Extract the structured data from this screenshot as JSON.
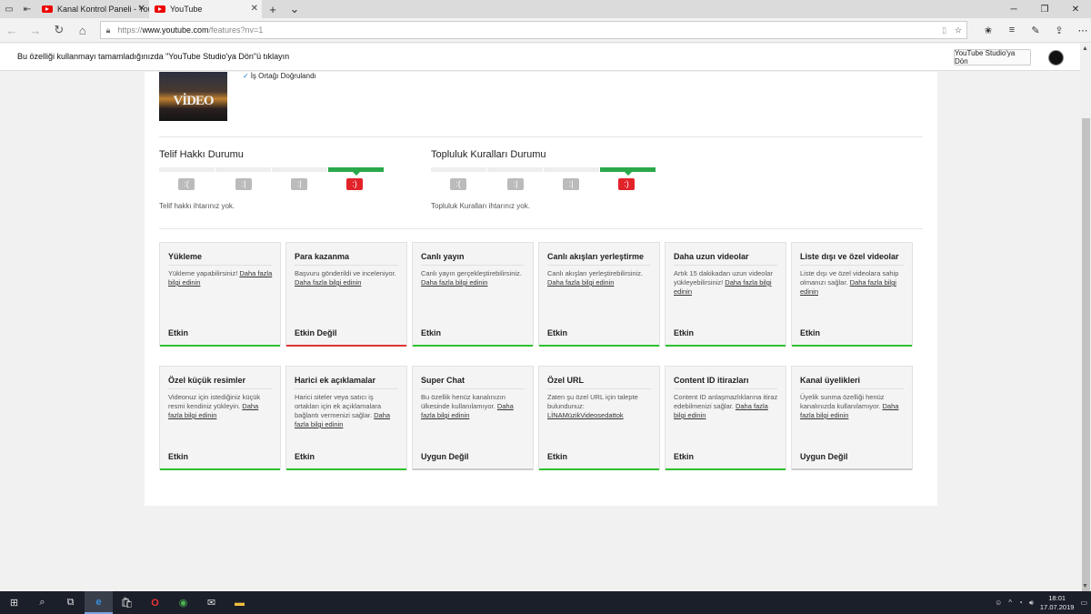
{
  "browser": {
    "tabs": [
      {
        "title": "Kanal Kontrol Paneli - YouTu",
        "active": false
      },
      {
        "title": "YouTube",
        "active": true
      }
    ],
    "url_prefix": "https://",
    "url_domain": "www.youtube.com",
    "url_path": "/features?nv=1"
  },
  "studio_bar": {
    "message": "Bu özelliği kullanmayı tamamladığınızda \"YouTube Studio'ya Dön\"ü tıklayın",
    "button": "YouTube Studio'ya Dön"
  },
  "channel": {
    "thumb_text": "VİDEO",
    "verified_label": "İş Ortağı Doğrulandı"
  },
  "copyright": {
    "title": "Telif Hakkı Durumu",
    "note": "Telif hakkı ihtarınız yok.",
    "level": 4
  },
  "community": {
    "title": "Topluluk Kuralları Durumu",
    "note": "Topluluk Kuralları ihtarınız yok.",
    "level": 4
  },
  "features": [
    {
      "title": "Yükleme",
      "desc": "Yükleme yapabilirsiniz!",
      "link": "Daha fazla bilgi edinin",
      "status": "Etkin",
      "state": "green"
    },
    {
      "title": "Para kazanma",
      "desc": "Başvuru gönderildi ve inceleniyor.",
      "link": "Daha fazla bilgi edinin",
      "status": "Etkin Değil",
      "state": "red"
    },
    {
      "title": "Canlı yayın",
      "desc": "Canlı yayın gerçekleştirebilirsiniz.",
      "link": "Daha fazla bilgi edinin",
      "status": "Etkin",
      "state": "green"
    },
    {
      "title": "Canlı akışları yerleştirme",
      "desc": "Canlı akışları yerleştirebilirsiniz.",
      "link": "Daha fazla bilgi edinin",
      "status": "Etkin",
      "state": "green"
    },
    {
      "title": "Daha uzun videolar",
      "desc": "Artık 15 dakikadan uzun videolar yükleyebilirsiniz!",
      "link": "Daha fazla bilgi edinin",
      "status": "Etkin",
      "state": "green"
    },
    {
      "title": "Liste dışı ve özel videolar",
      "desc": "Liste dışı ve özel videolara sahip olmanızı sağlar.",
      "link": "Daha fazla bilgi edinin",
      "status": "Etkin",
      "state": "green"
    },
    {
      "title": "Özel küçük resimler",
      "desc": "Videonuz için istediğiniz küçük resmi kendiniz yükleyin.",
      "link": "Daha fazla bilgi edinin",
      "status": "Etkin",
      "state": "green"
    },
    {
      "title": "Harici ek açıklamalar",
      "desc": "Harici siteler veya satıcı iş ortakları için ek açıklamalara bağlantı vermenizi sağlar.",
      "link": "Daha fazla bilgi edinin",
      "status": "Etkin",
      "state": "green"
    },
    {
      "title": "Super Chat",
      "desc": "Bu özellik henüz kanalınızın ülkesinde kullanılamıyor.",
      "link": "Daha fazla bilgi edinin",
      "status": "Uygun Değil",
      "state": "grey"
    },
    {
      "title": "Özel URL",
      "desc": "Zaten şu özel URL için talepte bulundunuz:",
      "link": "LİNAMüzikVideosedattok",
      "status": "Etkin",
      "state": "green"
    },
    {
      "title": "Content ID itirazları",
      "desc": "Content ID anlaşmazlıklarına itiraz edebilmenizi sağlar.",
      "link": "Daha fazla bilgi edinin",
      "status": "Etkin",
      "state": "green"
    },
    {
      "title": "Kanal üyelikleri",
      "desc": "Üyelik sunma özelliği henüz kanalınızda kullanılamıyor.",
      "link": "Daha fazla bilgi edinin",
      "status": "Uygun Değil",
      "state": "grey"
    }
  ],
  "taskbar": {
    "time": "18:01",
    "date": "17.07.2019"
  }
}
